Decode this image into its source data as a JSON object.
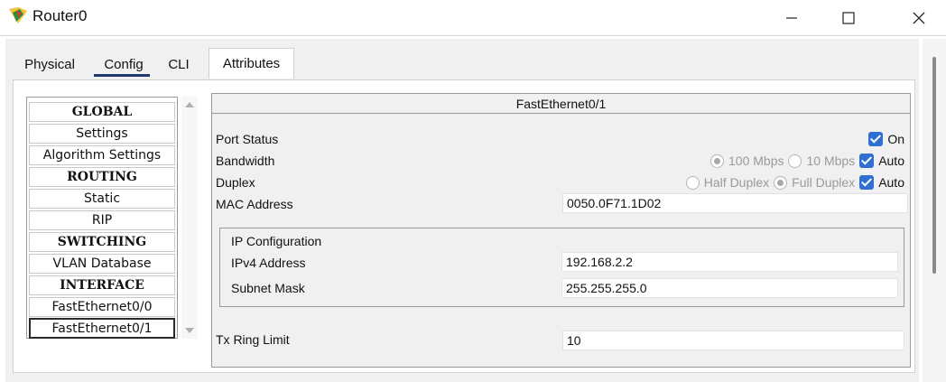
{
  "window": {
    "title": "Router0",
    "controls": {
      "minimize": "minimize",
      "maximize": "maximize",
      "close": "close"
    }
  },
  "tabs": [
    {
      "label": "Physical"
    },
    {
      "label": "Config"
    },
    {
      "label": "CLI"
    },
    {
      "label": "Attributes"
    }
  ],
  "nav": {
    "items": [
      {
        "label": "GLOBAL",
        "heading": true
      },
      {
        "label": "Settings"
      },
      {
        "label": "Algorithm Settings"
      },
      {
        "label": "ROUTING",
        "heading": true
      },
      {
        "label": "Static"
      },
      {
        "label": "RIP"
      },
      {
        "label": "SWITCHING",
        "heading": true
      },
      {
        "label": "VLAN Database"
      },
      {
        "label": "INTERFACE",
        "heading": true
      },
      {
        "label": "FastEthernet0/0"
      },
      {
        "label": "FastEthernet0/1",
        "selected": true
      }
    ]
  },
  "interface": {
    "title": "FastEthernet0/1",
    "port_status": {
      "label": "Port Status",
      "on_label": "On"
    },
    "bandwidth": {
      "label": "Bandwidth",
      "opt_100": "100 Mbps",
      "opt_10": "10 Mbps",
      "auto_label": "Auto"
    },
    "duplex": {
      "label": "Duplex",
      "opt_half": "Half Duplex",
      "opt_full": "Full Duplex",
      "auto_label": "Auto"
    },
    "mac": {
      "label": "MAC Address",
      "value": "0050.0F71.1D02"
    },
    "ip_config": {
      "heading": "IP Configuration",
      "ipv4_label": "IPv4 Address",
      "ipv4_value": "192.168.2.2",
      "mask_label": "Subnet Mask",
      "mask_value": "255.255.255.0"
    },
    "tx_ring": {
      "label": "Tx Ring Limit",
      "value": "10"
    }
  },
  "colors": {
    "checkbox": "#2f6fd1",
    "config_underline": "#1f3b6e"
  }
}
